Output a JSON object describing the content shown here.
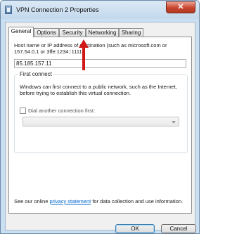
{
  "window": {
    "title": "VPN Connection 2 Properties",
    "close_symbol": "✕"
  },
  "tabs": [
    {
      "label": "General",
      "active": true
    },
    {
      "label": "Options",
      "active": false
    },
    {
      "label": "Security",
      "active": false
    },
    {
      "label": "Networking",
      "active": false
    },
    {
      "label": "Sharing",
      "active": false
    }
  ],
  "general": {
    "host_label": "Host name or IP address of destination (such as microsoft.com or 157.54.0.1 or 3ffe:1234::1111):",
    "host_value": "85.185.157.11",
    "first_connect": {
      "title": "First connect",
      "description": "Windows can first connect to a public network, such as the Internet, before trying to establish this virtual connection.",
      "dial_label": "Dial another connection first:",
      "dial_checked": false,
      "dial_value": ""
    },
    "footer_before": "See our online ",
    "footer_link": "privacy statement",
    "footer_after": " for data collection and use information."
  },
  "buttons": {
    "ok": "OK",
    "cancel": "Cancel"
  },
  "colors": {
    "arrow": "#d01818",
    "link": "#0066cc"
  },
  "icons": {
    "app": "network-connection-icon",
    "close": "close-icon",
    "combo_arrow": "chevron-down-icon",
    "pointer": "arrow-up-annotation"
  }
}
